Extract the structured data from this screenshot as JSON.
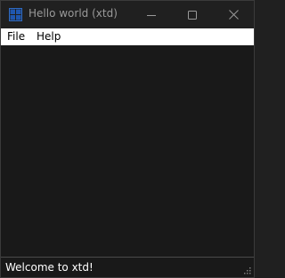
{
  "window": {
    "title": "Hello world (xtd)",
    "icon": "app-grid-icon",
    "controls": [
      "minimize-icon",
      "maximize-icon",
      "close-icon"
    ]
  },
  "menu": {
    "items": [
      {
        "label": "File"
      },
      {
        "label": "Help"
      }
    ]
  },
  "status": {
    "text": "Welcome to xtd!"
  },
  "colors": {
    "titlebar_bg": "#202020",
    "client_bg": "#191919",
    "menubar_bg": "#ffffff",
    "icon_accent": "#2e6bc4",
    "title_text": "#9a9a9a",
    "status_text": "#ffffff"
  }
}
